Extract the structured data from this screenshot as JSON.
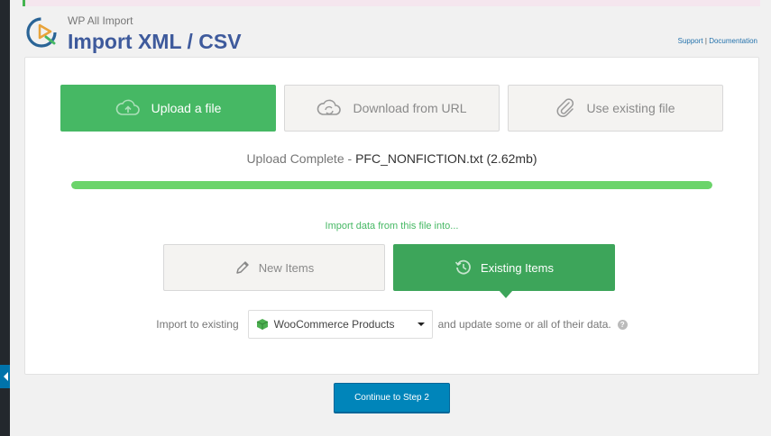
{
  "header": {
    "brand_name": "WP All Import",
    "title": "Import XML / CSV",
    "links": {
      "support": "Support",
      "separator": " | ",
      "documentation": "Documentation"
    }
  },
  "sources": {
    "upload": {
      "label": "Upload a file",
      "icon": "upload-cloud-icon",
      "active": true
    },
    "url": {
      "label": "Download from URL",
      "icon": "cloud-download-icon",
      "active": false
    },
    "existing": {
      "label": "Use existing file",
      "icon": "paperclip-icon",
      "active": false
    }
  },
  "upload_status": {
    "prefix": "Upload Complete",
    "separator": " - ",
    "filename": "PFC_NONFICTION.txt",
    "size": "(2.62mb)",
    "progress_percent": 100
  },
  "import_prompt": "Import data from this file into...",
  "import_type": {
    "new": {
      "label": "New Items",
      "icon": "pencil-icon",
      "active": false
    },
    "existing": {
      "label": "Existing Items",
      "icon": "history-icon",
      "active": true
    }
  },
  "import_existing": {
    "prefix": "Import to existing",
    "selected": "WooCommerce Products",
    "suffix": "and update some or all of their data.",
    "help": "?"
  },
  "continue_label": "Continue to Step 2",
  "colors": {
    "brand_title": "#3e5a9c",
    "active_tab": "#46b864",
    "active_type": "#3da55a",
    "progress": "#6bd46a",
    "primary_button": "#0085ba"
  }
}
